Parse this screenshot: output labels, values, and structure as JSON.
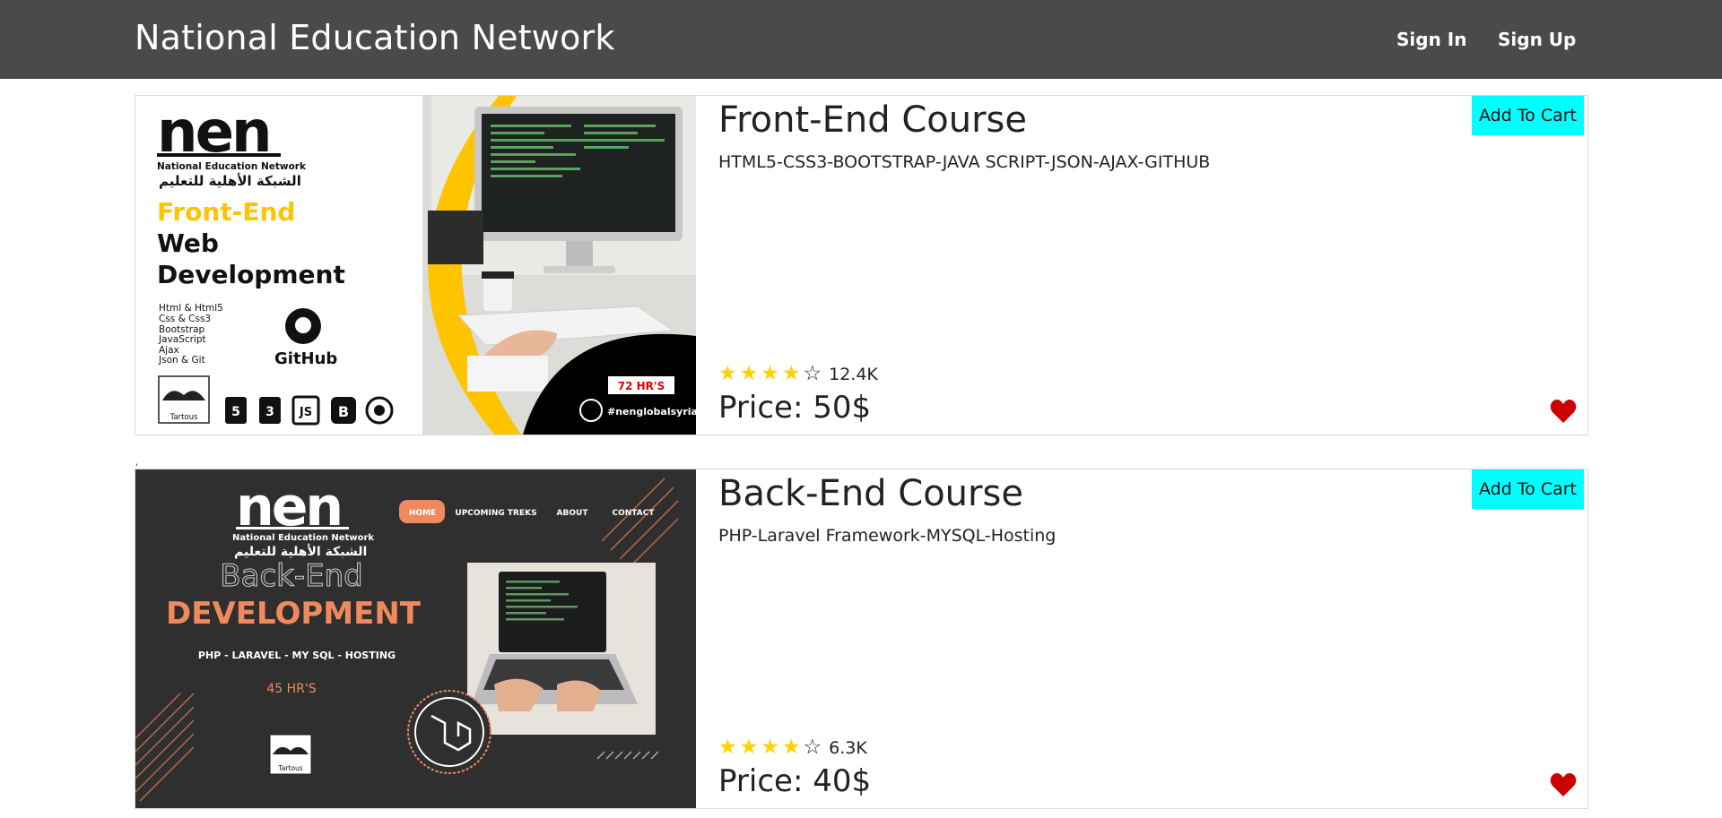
{
  "header": {
    "brand": "National Education Network",
    "sign_in": "Sign In",
    "sign_up": "Sign Up"
  },
  "separator_mark": ",",
  "courses": [
    {
      "title": "Front-End Course",
      "description": "HTML5-CSS3-BOOTSTRAP-JAVA SCRIPT-JSON-AJAX-GITHUB",
      "cart_label": "Add To Cart",
      "rating": {
        "stars": 4,
        "max": 5,
        "count": "12.4K"
      },
      "price": "Price: 50$",
      "image": {
        "logo": "nen",
        "logo_en": "National Education Network",
        "logo_ar": "الشبكة الأهلية للتعليم",
        "headline_1": "Front-End",
        "headline_2": "Web",
        "headline_3": "Development",
        "topics": [
          "Html & Html5",
          "Css & Css3",
          "Bootstrap",
          "JavaScript",
          "Ajax",
          "Json & Git"
        ],
        "github": "GitHub",
        "badge": "72 HR'S",
        "hashtag": "#nenglobalsyria",
        "seal": "Tartous",
        "tech_icons": [
          "5",
          "3",
          "JS",
          "B"
        ]
      }
    },
    {
      "title": "Back-End Course",
      "description": "PHP-Laravel Framework-MYSQL-Hosting",
      "cart_label": "Add To Cart",
      "rating": {
        "stars": 4,
        "max": 5,
        "count": "6.3K"
      },
      "price": "Price: 40$",
      "image": {
        "logo": "nen",
        "logo_en": "National Education Network",
        "logo_ar": "الشبكة الأهلية للتعليم",
        "menu": [
          "HOME",
          "UPCOMING TREKS",
          "ABOUT",
          "CONTACT"
        ],
        "headline_1": "Back-End",
        "headline_2": "DEVELOPMENT",
        "subline": "PHP - LARAVEL - MY SQL - HOSTING",
        "hours": "45 HR'S",
        "seal": "Tartous"
      }
    }
  ],
  "colors": {
    "navbar": "#4b4a49",
    "cart_button": "#00ffff",
    "star": "#ffd200",
    "heart": "#cc0000",
    "front_accent": "#ffc400",
    "back_accent": "#f08a5d"
  }
}
